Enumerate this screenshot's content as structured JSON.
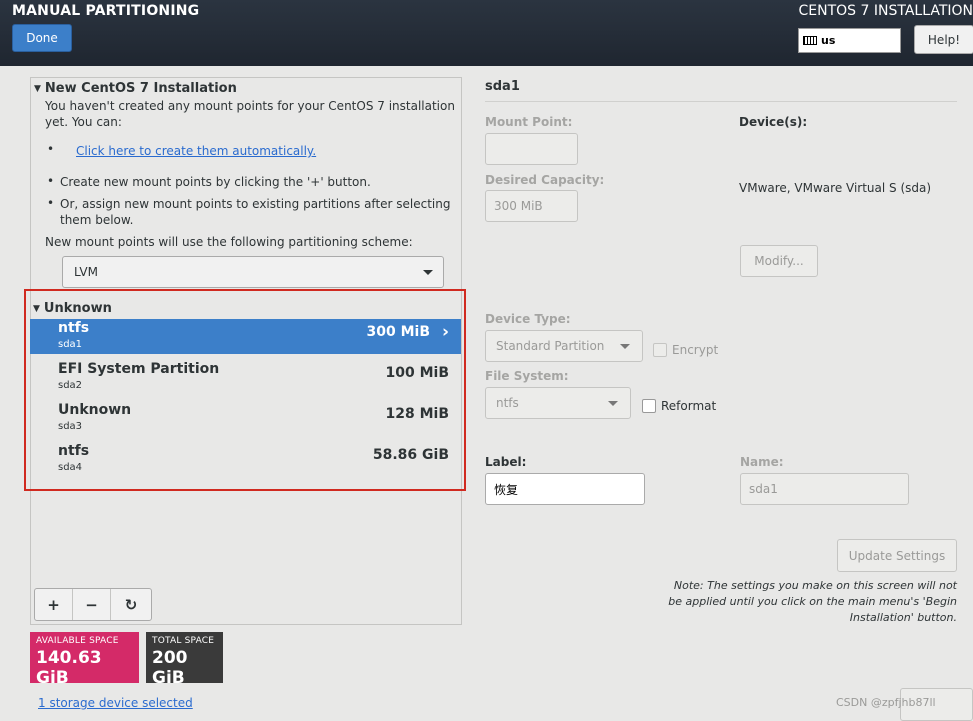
{
  "header": {
    "title": "MANUAL PARTITIONING",
    "installer_title": "CENTOS 7 INSTALLATION",
    "done_label": "Done",
    "keyboard_layout": "us",
    "help_label": "Help!"
  },
  "left": {
    "section_title": "New CentOS 7 Installation",
    "intro": "You haven't created any mount points for your CentOS 7 installation yet.  You can:",
    "auto_link": "Click here to create them automatically.",
    "bullet_plus": "Create new mount points by clicking the '+' button.",
    "bullet_assign": "Or, assign new mount points to existing partitions after selecting them below.",
    "scheme_text": "New mount points will use the following partitioning scheme:",
    "scheme_value": "LVM",
    "unknown_title": "Unknown",
    "partitions": [
      {
        "name": "ntfs",
        "device": "sda1",
        "size": "300 MiB",
        "selected": true
      },
      {
        "name": "EFI System Partition",
        "device": "sda2",
        "size": "100 MiB",
        "selected": false
      },
      {
        "name": "Unknown",
        "device": "sda3",
        "size": "128 MiB",
        "selected": false
      },
      {
        "name": "ntfs",
        "device": "sda4",
        "size": "58.86 GiB",
        "selected": false
      }
    ],
    "toolbar": {
      "add": "+",
      "remove": "−",
      "refresh": "↻"
    },
    "available_space_label": "AVAILABLE SPACE",
    "available_space_value": "140.63 GiB",
    "total_space_label": "TOTAL SPACE",
    "total_space_value": "200 GiB",
    "storage_link": "1 storage device selected"
  },
  "right": {
    "title": "sda1",
    "mount_point_label": "Mount Point:",
    "mount_point_value": "",
    "desired_capacity_label": "Desired Capacity:",
    "desired_capacity_value": "300 MiB",
    "devices_label": "Device(s):",
    "device_value": "VMware, VMware Virtual S (sda)",
    "modify_label": "Modify...",
    "device_type_label": "Device Type:",
    "device_type_value": "Standard Partition",
    "encrypt_label": "Encrypt",
    "file_system_label": "File System:",
    "file_system_value": "ntfs",
    "reformat_label": "Reformat",
    "label_label": "Label:",
    "label_value": "恢复",
    "name_label": "Name:",
    "name_value": "sda1",
    "update_label": "Update Settings",
    "note": "Note:  The settings you make on this screen will not be applied until you click on the main menu's 'Begin Installation' button."
  },
  "watermark": "CSDN @zpfjhb87ll"
}
